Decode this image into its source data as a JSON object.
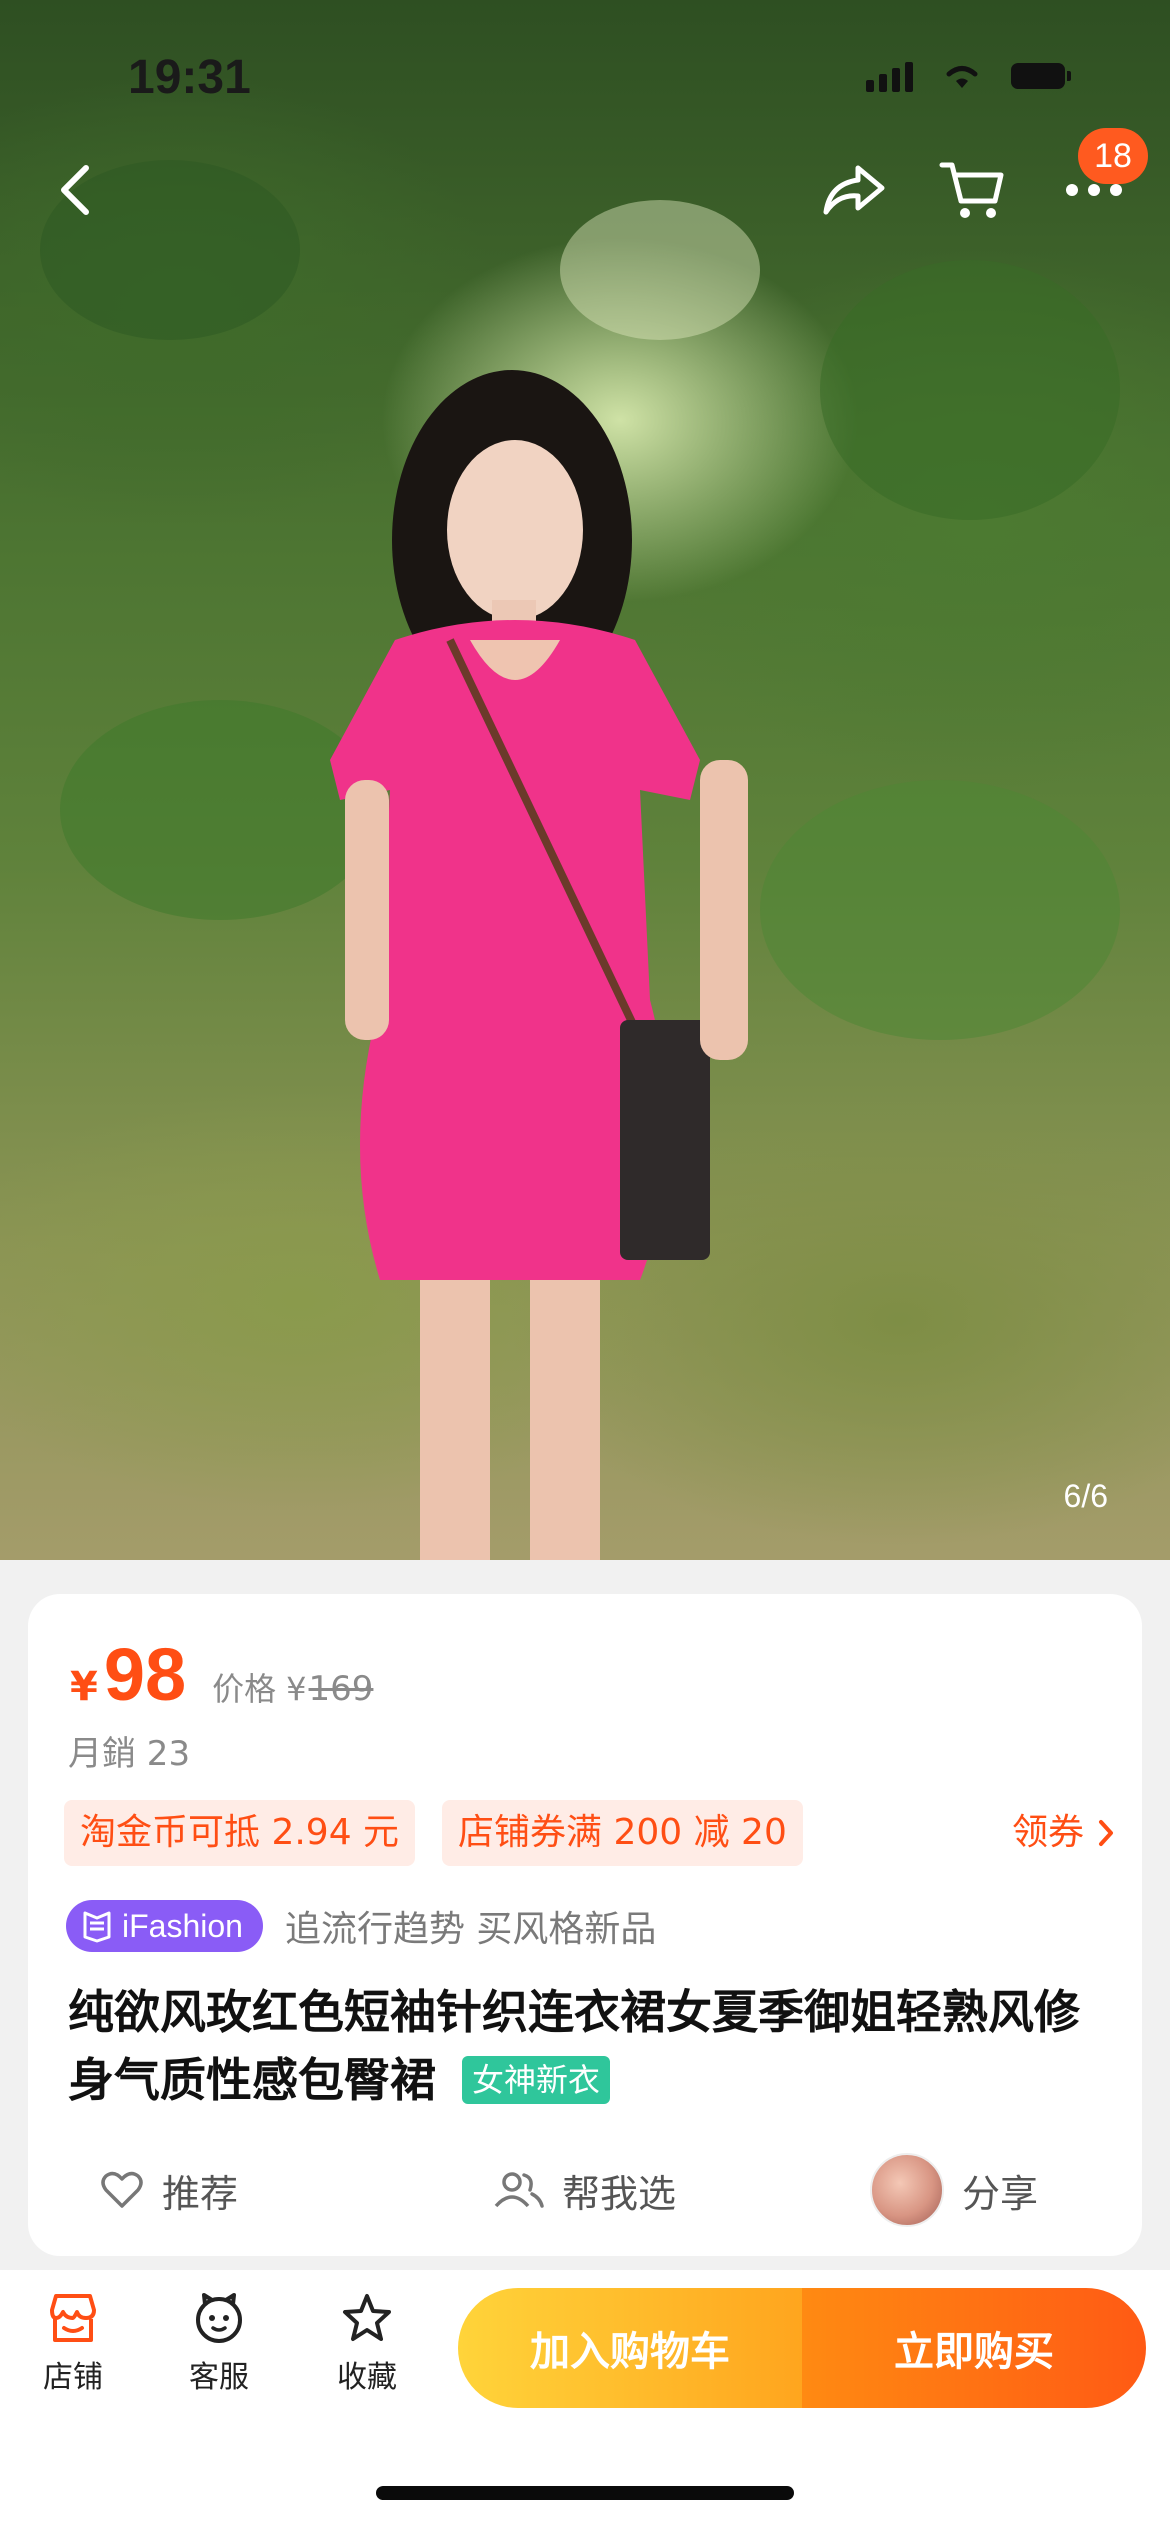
{
  "status_bar": {
    "time": "19:31"
  },
  "nav": {
    "cart_badge": "18"
  },
  "gallery": {
    "counter": "6/6"
  },
  "product": {
    "currency": "¥",
    "price": "98",
    "original_label": "价格",
    "original_currency": "¥",
    "original_price": "169",
    "monthly_sales": "月銷 23",
    "promos": [
      "淘金币可抵 2.94 元",
      "店铺券满 200 减 20"
    ],
    "coupon_label": "领券",
    "brand_tag": "iFashion",
    "brand_slogan": "追流行趋势 买风格新品",
    "title": "纯欲风玫红色短袖针织连衣裙女夏季御姐轻熟风修身气质性感包臀裙",
    "title_tag": "女神新衣"
  },
  "actions": {
    "recommend": "推荐",
    "help_choose": "帮我选",
    "share": "分享"
  },
  "bottom_bar": {
    "store": "店铺",
    "service": "客服",
    "favorite": "收藏",
    "add_to_cart": "加入购物车",
    "buy_now": "立即购买"
  },
  "colors": {
    "accent": "#ff4e14",
    "brand": "#8a5cf6",
    "tag_green": "#2fc69b",
    "cart_yellow": "#ffb620"
  }
}
